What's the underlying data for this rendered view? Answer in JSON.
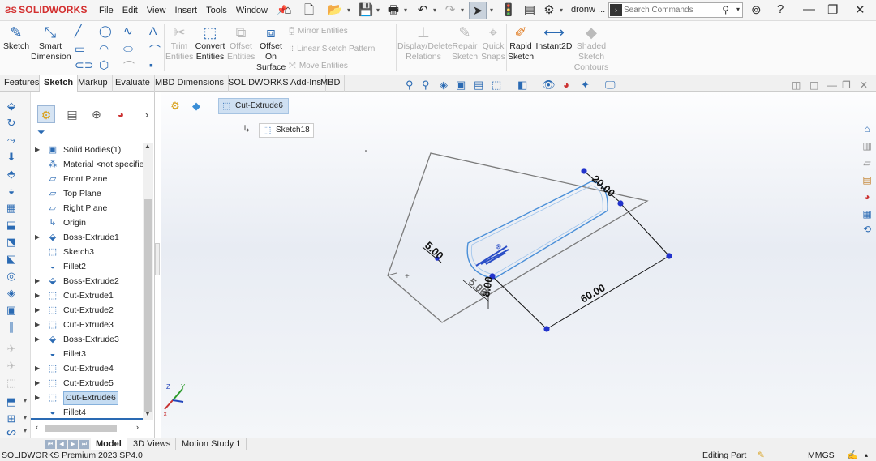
{
  "app": {
    "brand": "SOLIDWORKS",
    "doc_name": "dronw ..."
  },
  "menus": [
    "File",
    "Edit",
    "View",
    "Insert",
    "Tools",
    "Window"
  ],
  "search": {
    "placeholder": "Search Commands"
  },
  "ribbon": {
    "sketch": "Sketch",
    "smart_dimension": [
      "Smart",
      "Dimension"
    ],
    "trim_entities": [
      "Trim",
      "Entities"
    ],
    "convert_entities": [
      "Convert",
      "Entities"
    ],
    "offset_entities": [
      "Offset",
      "Entities"
    ],
    "offset_on_surface": [
      "Offset",
      "On",
      "Surface"
    ],
    "mirror_entities": "Mirror Entities",
    "linear_sketch_pattern": "Linear Sketch Pattern",
    "move_entities": "Move Entities",
    "display_delete_relations": [
      "Display/Delete",
      "Relations"
    ],
    "repair_sketch": [
      "Repair",
      "Sketch"
    ],
    "quick_snaps": [
      "Quick",
      "Snaps"
    ],
    "rapid_sketch": [
      "Rapid",
      "Sketch"
    ],
    "instant2d": "Instant2D",
    "shaded_sketch_contours": [
      "Shaded",
      "Sketch",
      "Contours"
    ]
  },
  "tabs": [
    "Features",
    "Sketch",
    "Markup",
    "Evaluate",
    "MBD Dimensions",
    "SOLIDWORKS Add-Ins",
    "MBD"
  ],
  "active_tab": "Sketch",
  "tree": [
    {
      "label": "Solid Bodies(1)",
      "expander": true,
      "icon": "solid-bodies-folder-icon"
    },
    {
      "label": "Material <not specified>",
      "expander": false,
      "icon": "material-icon"
    },
    {
      "label": "Front Plane",
      "expander": false,
      "icon": "plane-icon"
    },
    {
      "label": "Top Plane",
      "expander": false,
      "icon": "plane-icon"
    },
    {
      "label": "Right Plane",
      "expander": false,
      "icon": "plane-icon"
    },
    {
      "label": "Origin",
      "expander": false,
      "icon": "origin-icon"
    },
    {
      "label": "Boss-Extrude1",
      "expander": true,
      "icon": "boss-extrude-icon"
    },
    {
      "label": "Sketch3",
      "expander": false,
      "icon": "sketch-icon"
    },
    {
      "label": "Fillet2",
      "expander": false,
      "icon": "fillet-icon"
    },
    {
      "label": "Boss-Extrude2",
      "expander": true,
      "icon": "boss-extrude-icon"
    },
    {
      "label": "Cut-Extrude1",
      "expander": true,
      "icon": "cut-extrude-icon"
    },
    {
      "label": "Cut-Extrude2",
      "expander": true,
      "icon": "cut-extrude-icon"
    },
    {
      "label": "Cut-Extrude3",
      "expander": true,
      "icon": "cut-extrude-icon"
    },
    {
      "label": "Boss-Extrude3",
      "expander": true,
      "icon": "boss-extrude-icon"
    },
    {
      "label": "Fillet3",
      "expander": false,
      "icon": "fillet-icon"
    },
    {
      "label": "Cut-Extrude4",
      "expander": true,
      "icon": "cut-extrude-icon"
    },
    {
      "label": "Cut-Extrude5",
      "expander": true,
      "icon": "cut-extrude-icon"
    },
    {
      "label": "Cut-Extrude6",
      "expander": true,
      "icon": "cut-extrude-icon",
      "selected": true
    },
    {
      "label": "Fillet4",
      "expander": false,
      "icon": "fillet-icon"
    }
  ],
  "breadcrumb": {
    "feature": "Cut-Extrude6",
    "sketch": "Sketch18"
  },
  "dimensions": {
    "width": "20.00",
    "length": "60.00",
    "offset_a": "5.00",
    "offset_b": "5.00",
    "height": "8.00"
  },
  "triad": {
    "x": "X",
    "y": "Y",
    "z": "Z"
  },
  "bottom_tabs": [
    "Model",
    "3D Views",
    "Motion Study 1"
  ],
  "active_bottom_tab": "Model",
  "status": {
    "version": "SOLIDWORKS Premium 2023 SP4.0",
    "mode": "Editing Part",
    "units": "MMGS"
  },
  "colors": {
    "accent_blue": "#2a6ab3",
    "brand_red": "#d32f2f",
    "selection": "#c5dcf2"
  }
}
